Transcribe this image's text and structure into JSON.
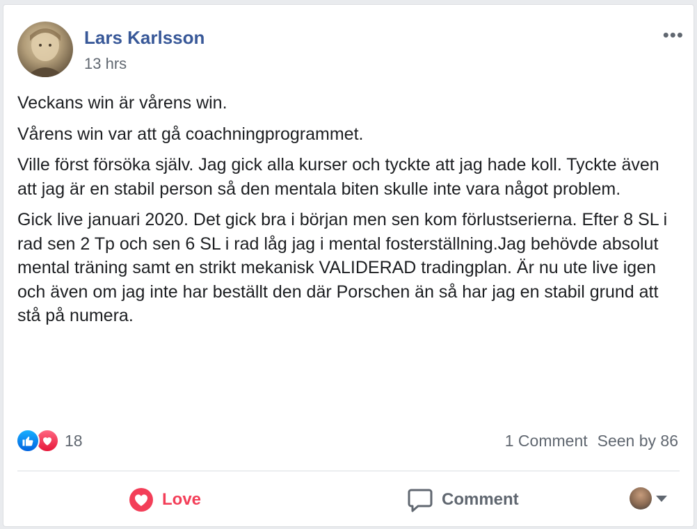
{
  "post": {
    "author": "Lars Karlsson",
    "time": "13 hrs",
    "paragraphs": [
      "Veckans win är vårens win.",
      "Vårens win var att gå coachningprogrammet.",
      "Ville först försöka själv. Jag gick alla kurser och tyckte att jag hade koll. Tyckte även att jag är en stabil person så den mentala biten skulle inte vara något problem.",
      "Gick live januari 2020. Det gick bra i början men sen kom förlustserierna. Efter 8 SL i rad sen 2 Tp och sen 6 SL i rad låg jag i mental fosterställning.Jag behövde absolut mental träning samt en strikt mekanisk VALIDERAD tradingplan. Är nu ute live igen och även om jag inte har beställt den där Porschen än så har jag en stabil grund att stå på numera."
    ],
    "more_label": "•••"
  },
  "stats": {
    "reaction_count": "18",
    "comments": "1 Comment",
    "seen_by": "Seen by 86"
  },
  "actions": {
    "love_label": "Love",
    "comment_label": "Comment"
  },
  "colors": {
    "author": "#385898",
    "love": "#f33e58",
    "like": "#1877f2",
    "muted": "#606770"
  },
  "icons": [
    "like-reaction-icon",
    "love-reaction-icon",
    "heart-icon",
    "comment-bubble-icon",
    "chevron-down-icon"
  ]
}
